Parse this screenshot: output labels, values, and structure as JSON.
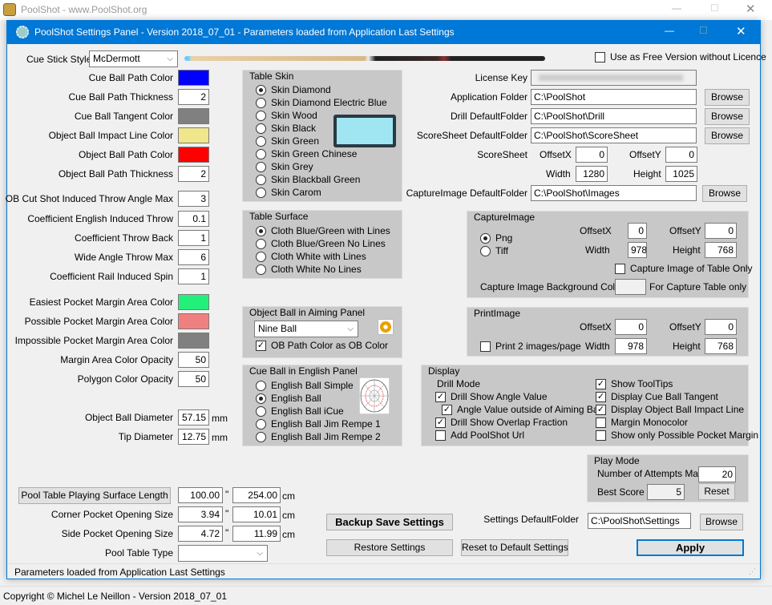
{
  "outer": {
    "title": "PoolShot - www.PoolShot.org",
    "footer": "Copyright © Michel Le Neillon - Version 2018_07_01"
  },
  "dialog": {
    "title": "PoolShot Settings Panel - Version 2018_07_01 - Parameters loaded from Application Last Settings",
    "status": "Parameters loaded from Application Last Settings"
  },
  "cue": {
    "label": "Cue Stick Style",
    "value": "McDermott",
    "free_version": "Use as Free Version without Licence",
    "free_checked": false
  },
  "left": [
    {
      "label": "Cue Ball Path Color",
      "color": "#0000ff"
    },
    {
      "label": "Cue Ball Path Thickness",
      "value": "2"
    },
    {
      "label": "Cue Ball Tangent Color",
      "color": "#808080"
    },
    {
      "label": "Object Ball Impact Line Color",
      "color": "#f0e68c"
    },
    {
      "label": "Object Ball Path Color",
      "color": "#ff0000"
    },
    {
      "label": "Object Ball Path Thickness",
      "value": "2"
    },
    {
      "label": "OB Cut Shot Induced Throw Angle Max",
      "value": "3"
    },
    {
      "label": "Coefficient English Induced Throw",
      "value": "0.1"
    },
    {
      "label": "Coefficient Throw Back",
      "value": "1"
    },
    {
      "label": "Wide Angle Throw Max",
      "value": "6"
    },
    {
      "label": "Coefficient Rail Induced Spin",
      "value": "1"
    },
    {
      "label": "Easiest Pocket Margin Area Color",
      "color": "#22f07a"
    },
    {
      "label": "Possible Pocket Margin Area Color",
      "color": "#f08080"
    },
    {
      "label": "Impossible Pocket Margin Area Color",
      "color": "#808080"
    },
    {
      "label": "Margin Area Color Opacity",
      "value": "50"
    },
    {
      "label": "Polygon Color Opacity",
      "value": "50"
    },
    {
      "label": "Object Ball Diameter",
      "value": "57.15",
      "unit": "mm"
    },
    {
      "label": "Tip Diameter",
      "value": "12.75",
      "unit": "mm"
    }
  ],
  "table_skin": {
    "title": "Table Skin",
    "selected": 0,
    "options": [
      "Skin Diamond",
      "Skin Diamond Electric Blue",
      "Skin Wood",
      "Skin Black",
      "Skin Green",
      "Skin Green Chinese",
      "Skin Grey",
      "Skin Blackball Green",
      "Skin Carom"
    ]
  },
  "table_surface": {
    "title": "Table Surface",
    "selected": 0,
    "options": [
      "Cloth Blue/Green with Lines",
      "Cloth Blue/Green No Lines",
      "Cloth White with Lines",
      "Cloth White No Lines"
    ]
  },
  "ob_panel": {
    "title": "Object Ball in Aiming Panel",
    "value": "Nine Ball",
    "checkbox": "OB Path Color as OB Color",
    "checked": true
  },
  "cb_panel": {
    "title": "Cue Ball in English Panel",
    "selected": 1,
    "options": [
      "English Ball Simple",
      "English Ball",
      "English Ball iCue",
      "English Ball Jim Rempe 1",
      "English Ball Jim Rempe 2"
    ]
  },
  "folders": {
    "license_label": "License Key",
    "license_value": "",
    "browse": "Browse",
    "app_label": "Application Folder",
    "app": "C:\\PoolShot",
    "drill_label": "Drill DefaultFolder",
    "drill": "C:\\PoolShot\\Drill",
    "score_label": "ScoreSheet DefaultFolder",
    "score": "C:\\PoolShot\\ScoreSheet",
    "capture_label": "CaptureImage DefaultFolder",
    "capture": "C:\\PoolShot\\Images"
  },
  "scoresheet": {
    "label": "ScoreSheet",
    "offx_label": "OffsetX",
    "offx": "0",
    "offy_label": "OffsetY",
    "offy": "0",
    "w_label": "Width",
    "w": "1280",
    "h_label": "Height",
    "h": "1025"
  },
  "capture": {
    "title": "CaptureImage",
    "png": "Png",
    "tiff": "Tiff",
    "offx_label": "OffsetX",
    "offx": "0",
    "offy_label": "OffsetY",
    "offy": "0",
    "w_label": "Width",
    "w": "978",
    "h_label": "Height",
    "h": "768",
    "table_only": "Capture Image of Table Only",
    "bg_label": "Capture Image Background Color",
    "bg_note": "For Capture Table only",
    "bg_color": "#f0f0f0"
  },
  "print": {
    "title": "PrintImage",
    "offx_label": "OffsetX",
    "offx": "0",
    "offy_label": "OffsetY",
    "offy": "0",
    "two": "Print 2 images/page",
    "w_label": "Width",
    "w": "978",
    "h_label": "Height",
    "h": "768"
  },
  "display": {
    "title": "Display",
    "drill_mode": "Drill Mode",
    "left": [
      {
        "label": "Drill Show Angle Value",
        "checked": true
      },
      {
        "label": "Angle Value outside of Aiming Ball",
        "checked": true
      },
      {
        "label": "Drill Show Overlap Fraction",
        "checked": true
      },
      {
        "label": "Add PoolShot Url",
        "checked": false
      }
    ],
    "right": [
      {
        "label": "Show ToolTips",
        "checked": true
      },
      {
        "label": "Display Cue Ball Tangent",
        "checked": true
      },
      {
        "label": "Display Object Ball Impact Line",
        "checked": true
      },
      {
        "label": "Margin Monocolor",
        "checked": false
      },
      {
        "label": "Show only Possible Pocket Margin",
        "checked": false
      }
    ]
  },
  "play": {
    "title": "Play Mode",
    "attempts_label": "Number of Attempts Max",
    "attempts": "20",
    "best_label": "Best Score",
    "best": "5",
    "reset": "Reset"
  },
  "sizes": {
    "length_button": "Pool Table Playing Surface Length",
    "length_in": "100.00",
    "length_cm": "254.00",
    "corner_label": "Corner Pocket Opening Size",
    "corner_in": "3.94",
    "corner_cm": "10.01",
    "side_label": "Side Pocket Opening Size",
    "side_in": "4.72",
    "side_cm": "11.99",
    "inch": "\"",
    "cm": "cm",
    "type_label": "Pool Table Type",
    "type_value": ""
  },
  "actions": {
    "backup": "Backup Save Settings",
    "restore": "Restore Settings",
    "reset_default": "Reset to Default Settings",
    "settings_label": "Settings DefaultFolder",
    "settings": "C:\\PoolShot\\Settings",
    "browse": "Browse",
    "apply": "Apply"
  }
}
